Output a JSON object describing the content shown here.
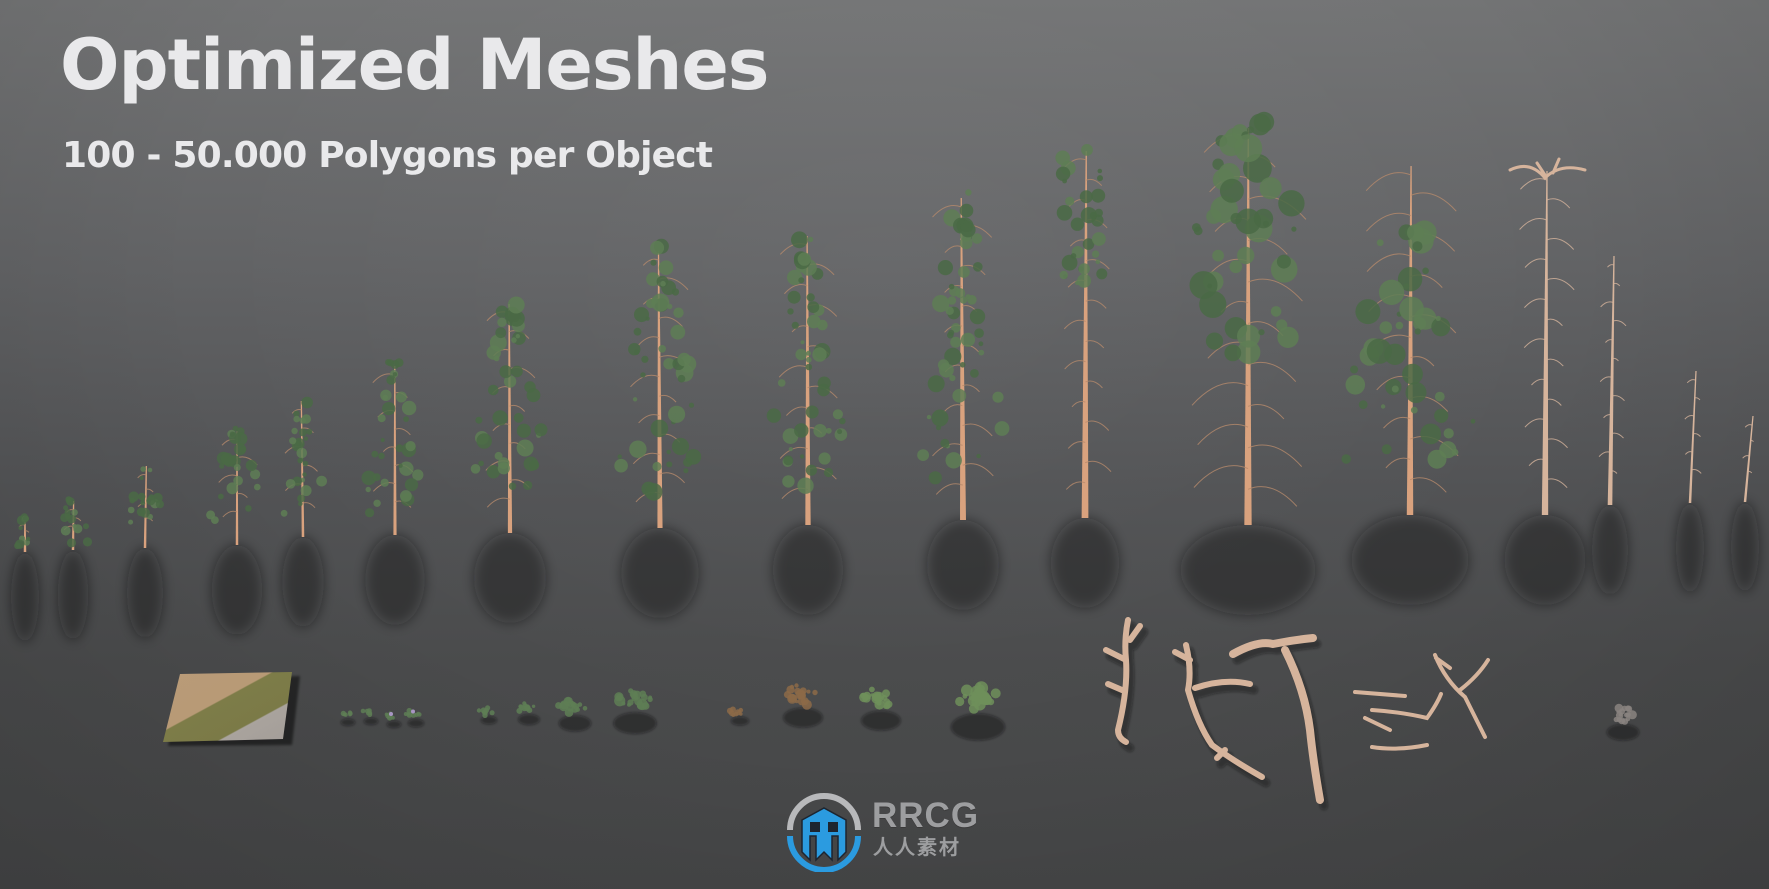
{
  "header": {
    "title": "Optimized Meshes",
    "subtitle": "100 - 50.000 Polygons per Object"
  },
  "watermark": {
    "brand": "RRCG",
    "brand_sub": "人人素材",
    "icon": "rrcg-logo-icon",
    "colors": {
      "ring_blue": "#2b9be0",
      "ring_gray": "#b8b9bb",
      "text": "#9d9ea0"
    }
  },
  "scene": {
    "background": {
      "top": "#737475",
      "bottom": "#454647"
    },
    "colors": {
      "foliage": "#4a6a45",
      "foliage_light": "#5e7e55",
      "bark": "#d9a27e",
      "bark_dead": "#d6b49c",
      "fern_dry": "#8c6a48",
      "fern_green": "#6f8f5a"
    },
    "trees": [
      {
        "kind": "pine-sapling",
        "foliage": true
      },
      {
        "kind": "pine-sapling",
        "foliage": true
      },
      {
        "kind": "pine-young",
        "foliage": true
      },
      {
        "kind": "pine-young",
        "foliage": true
      },
      {
        "kind": "pine-young",
        "foliage": true
      },
      {
        "kind": "pine-medium",
        "foliage": true
      },
      {
        "kind": "pine-medium",
        "foliage": true
      },
      {
        "kind": "pine-tall",
        "foliage": true
      },
      {
        "kind": "pine-tall",
        "foliage": true
      },
      {
        "kind": "pine-tall-sparse",
        "foliage": true
      },
      {
        "kind": "pine-mature",
        "foliage": true
      },
      {
        "kind": "pine-old-crown",
        "foliage": true
      },
      {
        "kind": "pine-dying",
        "foliage": true
      },
      {
        "kind": "snag-crown",
        "foliage": false
      },
      {
        "kind": "snag",
        "foliage": false
      },
      {
        "kind": "snag",
        "foliage": false
      },
      {
        "kind": "snag",
        "foliage": false
      }
    ],
    "ground_items": [
      {
        "kind": "ground-tile",
        "label": "terrain patch"
      },
      {
        "kind": "plant-small"
      },
      {
        "kind": "plant-small"
      },
      {
        "kind": "plant-flower"
      },
      {
        "kind": "plant-flower"
      },
      {
        "kind": "shrub"
      },
      {
        "kind": "shrub"
      },
      {
        "kind": "shrub"
      },
      {
        "kind": "shrub"
      },
      {
        "kind": "fern-dry"
      },
      {
        "kind": "fern-dry"
      },
      {
        "kind": "fern-green"
      },
      {
        "kind": "fern-green"
      },
      {
        "kind": "deadwood-branch"
      },
      {
        "kind": "deadwood-branch"
      },
      {
        "kind": "deadwood-branch"
      },
      {
        "kind": "deadwood-pile"
      },
      {
        "kind": "twigs"
      }
    ]
  }
}
